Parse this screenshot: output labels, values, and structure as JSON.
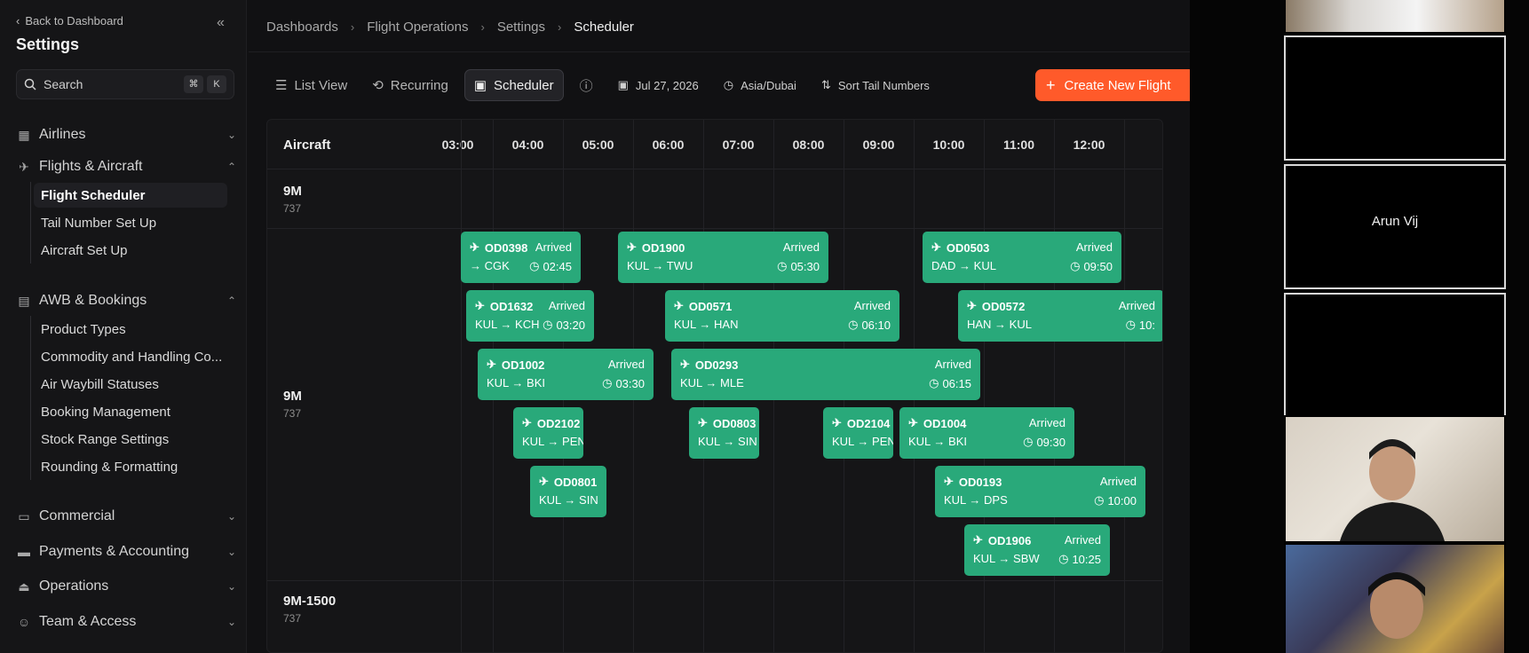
{
  "sidebar": {
    "back_label": "Back to Dashboard",
    "title": "Settings",
    "search_placeholder": "Search",
    "kbd": [
      "⌘",
      "K"
    ],
    "groups": {
      "airlines": "Airlines",
      "flights_aircraft": "Flights & Aircraft",
      "awb_bookings": "AWB & Bookings",
      "commercial": "Commercial",
      "payments": "Payments & Accounting",
      "operations": "Operations",
      "team": "Team & Access"
    },
    "flights_items": [
      "Flight Scheduler",
      "Tail Number Set Up",
      "Aircraft Set Up"
    ],
    "awb_items": [
      "Product Types",
      "Commodity and Handling Co...",
      "Air Waybill Statuses",
      "Booking Management",
      "Stock Range Settings",
      "Rounding & Formatting"
    ]
  },
  "breadcrumb": [
    "Dashboards",
    "Flight Operations",
    "Settings",
    "Scheduler"
  ],
  "toolbar": {
    "list_view": "List View",
    "recurring": "Recurring",
    "scheduler": "Scheduler",
    "date": "Jul 27, 2026",
    "timezone": "Asia/Dubai",
    "sort": "Sort Tail Numbers",
    "create": "Create New Flight"
  },
  "grid": {
    "aircraft_header": "Aircraft",
    "hours": [
      "03:00",
      "04:00",
      "05:00",
      "06:00",
      "07:00",
      "08:00",
      "09:00",
      "10:00",
      "11:00",
      "12:00"
    ],
    "rows": [
      {
        "reg": "9M",
        "type": "737"
      },
      {
        "reg": "9M",
        "type": "737"
      },
      {
        "reg": "9M-1500",
        "type": "737"
      }
    ]
  },
  "flights": [
    {
      "no": "OD0398",
      "status": "Arrived",
      "route": "→ CGK",
      "time": "02:45"
    },
    {
      "no": "OD1900",
      "status": "Arrived",
      "route": "KUL → TWU",
      "time": "05:30"
    },
    {
      "no": "OD0503",
      "status": "Arrived",
      "route": "DAD → KUL",
      "time": "09:50"
    },
    {
      "no": "OD1632",
      "status": "Arrived",
      "route": "KUL → KCH",
      "time": "03:20"
    },
    {
      "no": "OD0571",
      "status": "Arrived",
      "route": "KUL → HAN",
      "time": "06:10"
    },
    {
      "no": "OD0572",
      "status": "Arrived",
      "route": "HAN → KUL",
      "time": "10:"
    },
    {
      "no": "OD1002",
      "status": "Arrived",
      "route": "KUL → BKI",
      "time": "03:30"
    },
    {
      "no": "OD0293",
      "status": "Arrived",
      "route": "KUL → MLE",
      "time": "06:15"
    },
    {
      "no": "OD2102",
      "status": "",
      "route": "KUL → PEN",
      "time": ""
    },
    {
      "no": "OD0803",
      "status": "",
      "route": "KUL → SIN",
      "time": ""
    },
    {
      "no": "OD2104",
      "status": "",
      "route": "KUL → PEN",
      "time": ""
    },
    {
      "no": "OD1004",
      "status": "Arrived",
      "route": "KUL → BKI",
      "time": "09:30"
    },
    {
      "no": "OD0801",
      "status": "",
      "route": "KUL → SIN",
      "time": ""
    },
    {
      "no": "OD0193",
      "status": "Arrived",
      "route": "KUL → DPS",
      "time": "10:00"
    },
    {
      "no": "OD1906",
      "status": "Arrived",
      "route": "KUL → SBW",
      "time": "10:25"
    }
  ],
  "video": {
    "participant_name": "Arun Vij"
  },
  "colors": {
    "flight_block": "#29a97a",
    "create_button": "#ff5a2a",
    "background": "#111113"
  }
}
